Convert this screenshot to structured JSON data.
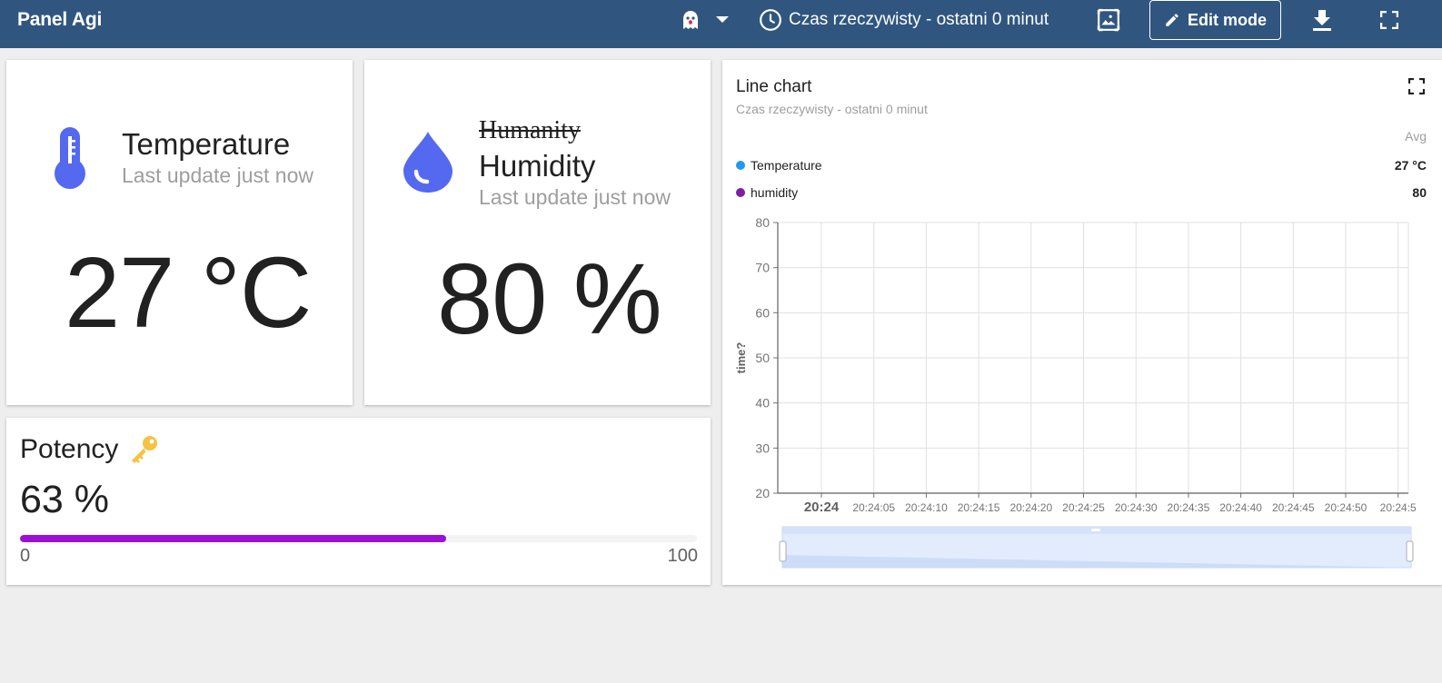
{
  "topbar": {
    "title": "Panel Agi",
    "time_window": "Czas rzeczywisty - ostatni 0 minut",
    "edit_mode": "Edit mode",
    "bg": "#305680"
  },
  "temperature": {
    "title": "Temperature",
    "subtitle": "Last update just now",
    "value": "27 °C",
    "icon_color": "#5469f0"
  },
  "humidity": {
    "struck_title": "Humanity",
    "title": "Humidity",
    "subtitle": "Last update just now",
    "value": "80 %",
    "icon_color": "#5469f0"
  },
  "potency": {
    "title": "Potency",
    "value": "63 %",
    "progress": 63,
    "min": "0",
    "max": "100",
    "bar_color": "#9c0fd8"
  },
  "chart": {
    "title": "Line chart",
    "subtitle": "Czas rzeczywisty - ostatni 0 minut",
    "avg_label": "Avg"
  },
  "chart_data": {
    "type": "line",
    "ylabel": "time?",
    "ylim": [
      20,
      80
    ],
    "yticks": [
      80,
      70,
      60,
      50,
      40,
      30,
      20
    ],
    "xticks": [
      "20:24",
      "20:24:05",
      "20:24:10",
      "20:24:15",
      "20:24:20",
      "20:24:25",
      "20:24:30",
      "20:24:35",
      "20:24:40",
      "20:24:45",
      "20:24:50",
      "20:24:5"
    ],
    "grid": true,
    "legend": "top-left",
    "series": [
      {
        "name": "Temperature",
        "avg": "27 °C",
        "color": "#2196f3",
        "values": []
      },
      {
        "name": "humidity",
        "avg": "80",
        "color": "#7b1fa2",
        "values": []
      }
    ]
  }
}
